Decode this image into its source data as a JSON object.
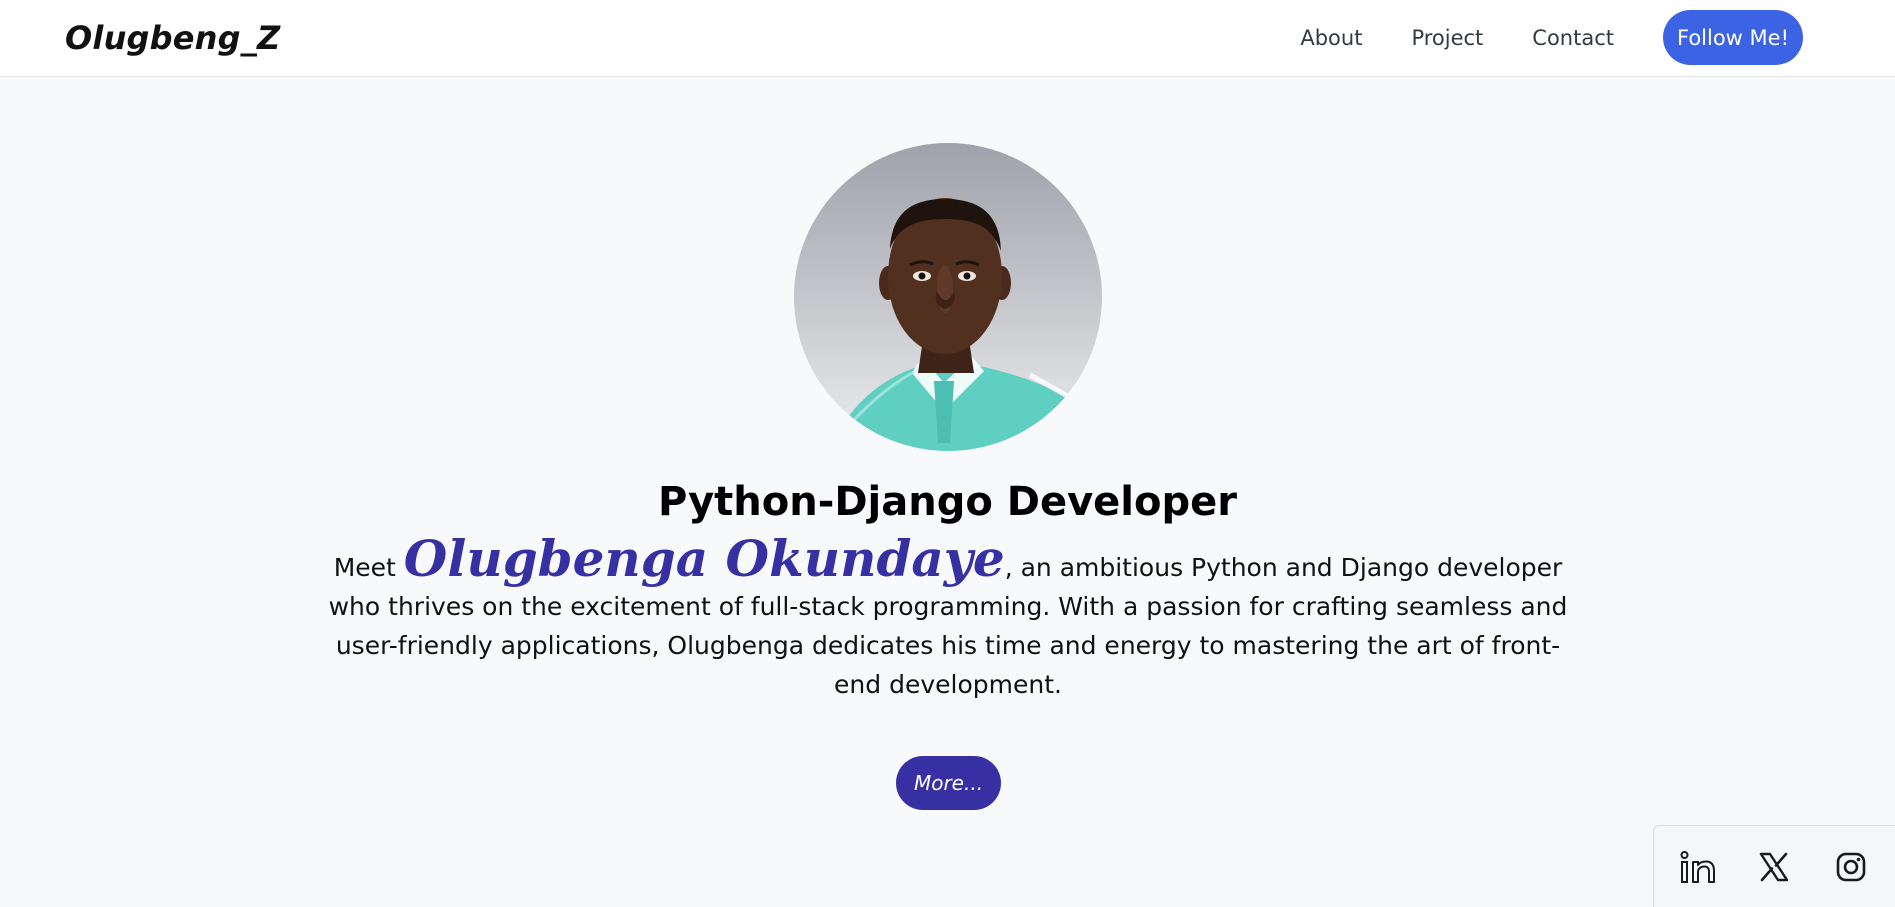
{
  "nav": {
    "brand": "Olugbeng_Z",
    "links": [
      {
        "label": "About"
      },
      {
        "label": "Project"
      },
      {
        "label": "Contact"
      }
    ],
    "follow_label": "Follow Me!"
  },
  "hero": {
    "headline": "Python-Django Developer",
    "intro_prefix": "Meet ",
    "name": "Olugbenga Okundaye",
    "intro_rest": ", an ambitious Python and Django developer who thrives on the excitement of full-stack programming. With a passion for crafting seamless and user-friendly applications, Olugbenga dedicates his time and energy to mastering the art of front-end development.",
    "more_label": "More..."
  },
  "social": {
    "items": [
      {
        "icon": "linkedin-icon"
      },
      {
        "icon": "x-twitter-icon"
      },
      {
        "icon": "instagram-icon"
      }
    ]
  },
  "colors": {
    "accent_blue": "#3b63e3",
    "accent_indigo": "#3730a3",
    "page_background": "#f8f9fb"
  }
}
